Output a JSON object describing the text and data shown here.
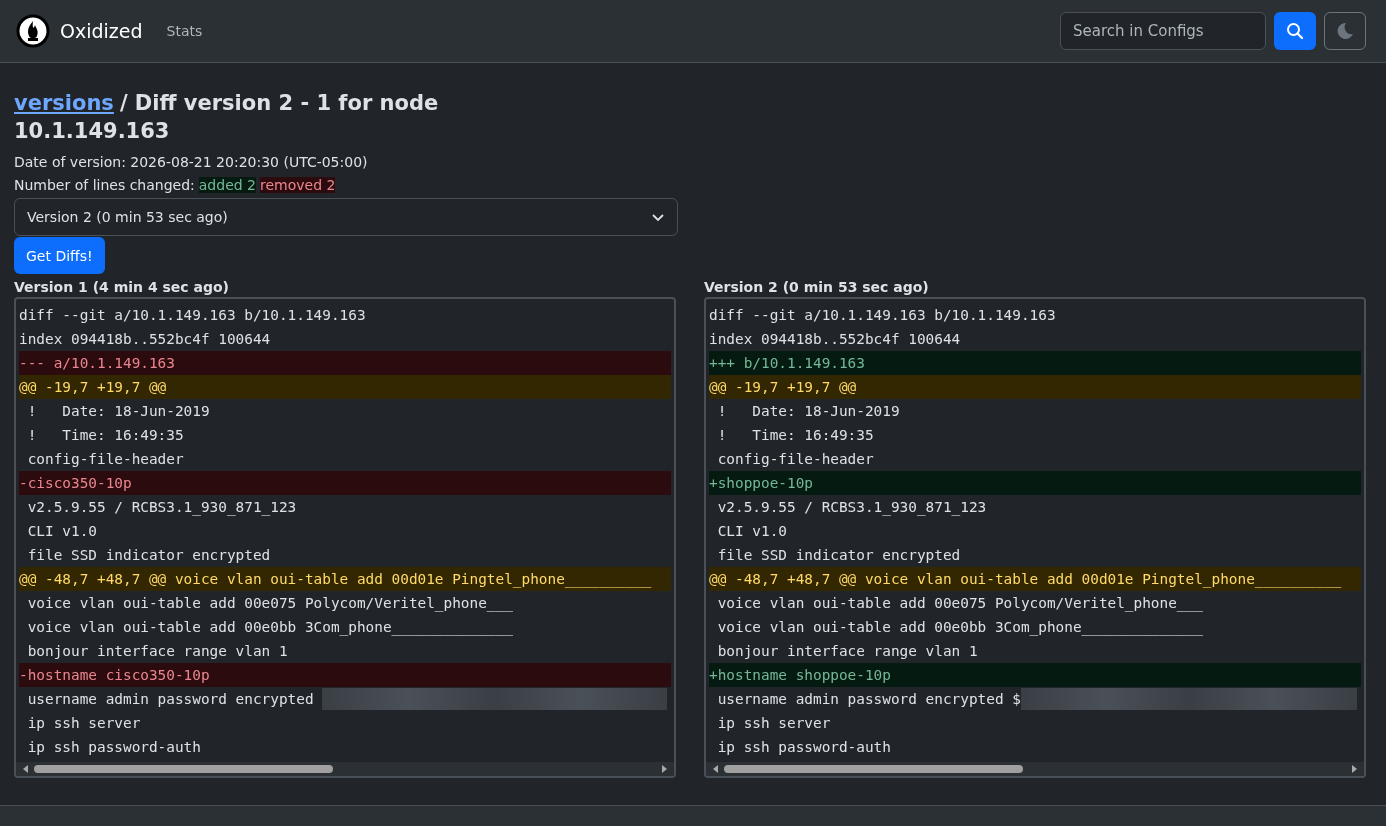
{
  "navbar": {
    "brand": "Oxidized",
    "links": [
      {
        "label": "Stats"
      }
    ],
    "search": {
      "placeholder": "Search in Configs"
    }
  },
  "title": {
    "link": "versions",
    "text": "/ Diff version 2 - 1 for node",
    "node": "10.1.149.163"
  },
  "date_line": "Date of version: 2026-08-21 20:20:30 (UTC-05:00)",
  "changes": {
    "label": "Number of lines changed:",
    "added": "added 2",
    "removed": "removed 2"
  },
  "version_select": {
    "value": "Version 2 (0 min 53 sec ago)"
  },
  "get_diffs_button": "Get Diffs!",
  "panels": [
    {
      "heading": "Version 1 (4 min 4 sec ago)",
      "lines": [
        {
          "kind": "meta",
          "text": "diff --git a/10.1.149.163 b/10.1.149.163"
        },
        {
          "kind": "meta",
          "text": "index 094418b..552bc4f 100644"
        },
        {
          "kind": "removed",
          "text": "--- a/10.1.149.163"
        },
        {
          "kind": "hunk",
          "text": "@@ -19,7 +19,7 @@"
        },
        {
          "kind": "context",
          "text": " !   Date: 18-Jun-2019"
        },
        {
          "kind": "context",
          "text": " !   Time: 16:49:35"
        },
        {
          "kind": "context",
          "text": " config-file-header"
        },
        {
          "kind": "removed",
          "text": "-cisco350-10p"
        },
        {
          "kind": "context",
          "text": " v2.5.9.55 / RCBS3.1_930_871_123"
        },
        {
          "kind": "context",
          "text": " CLI v1.0"
        },
        {
          "kind": "context",
          "text": " file SSD indicator encrypted"
        },
        {
          "kind": "hunk",
          "text": "@@ -48,7 +48,7 @@ voice vlan oui-table add 00d01e Pingtel_phone__________"
        },
        {
          "kind": "context",
          "text": " voice vlan oui-table add 00e075 Polycom/Veritel_phone___"
        },
        {
          "kind": "context",
          "text": " voice vlan oui-table add 00e0bb 3Com_phone______________"
        },
        {
          "kind": "context",
          "text": " bonjour interface range vlan 1"
        },
        {
          "kind": "removed",
          "text": "-hostname cisco350-10p"
        },
        {
          "kind": "redacted",
          "text": " username admin password encrypted "
        },
        {
          "kind": "context",
          "text": " ip ssh server"
        },
        {
          "kind": "context",
          "text": " ip ssh password-auth"
        }
      ]
    },
    {
      "heading": "Version 2 (0 min 53 sec ago)",
      "lines": [
        {
          "kind": "meta",
          "text": "diff --git a/10.1.149.163 b/10.1.149.163"
        },
        {
          "kind": "meta",
          "text": "index 094418b..552bc4f 100644"
        },
        {
          "kind": "added",
          "text": "+++ b/10.1.149.163"
        },
        {
          "kind": "hunk",
          "text": "@@ -19,7 +19,7 @@"
        },
        {
          "kind": "context",
          "text": " !   Date: 18-Jun-2019"
        },
        {
          "kind": "context",
          "text": " !   Time: 16:49:35"
        },
        {
          "kind": "context",
          "text": " config-file-header"
        },
        {
          "kind": "added",
          "text": "+shoppoe-10p"
        },
        {
          "kind": "context",
          "text": " v2.5.9.55 / RCBS3.1_930_871_123"
        },
        {
          "kind": "context",
          "text": " CLI v1.0"
        },
        {
          "kind": "context",
          "text": " file SSD indicator encrypted"
        },
        {
          "kind": "hunk",
          "text": "@@ -48,7 +48,7 @@ voice vlan oui-table add 00d01e Pingtel_phone__________"
        },
        {
          "kind": "context",
          "text": " voice vlan oui-table add 00e075 Polycom/Veritel_phone___"
        },
        {
          "kind": "context",
          "text": " voice vlan oui-table add 00e0bb 3Com_phone______________"
        },
        {
          "kind": "context",
          "text": " bonjour interface range vlan 1"
        },
        {
          "kind": "added",
          "text": "+hostname shoppoe-10p"
        },
        {
          "kind": "redacted",
          "text": " username admin password encrypted $"
        },
        {
          "kind": "context",
          "text": " ip ssh server"
        },
        {
          "kind": "context",
          "text": " ip ssh password-auth"
        }
      ]
    }
  ]
}
